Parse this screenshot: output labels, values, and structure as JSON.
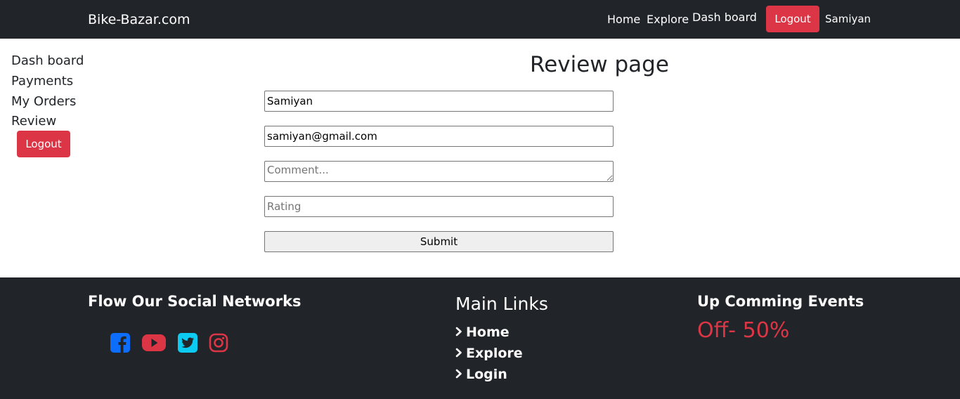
{
  "navbar": {
    "brand": "Bike-Bazar.com",
    "links": [
      "Home",
      "Explore",
      "Dash board"
    ],
    "logout_label": "Logout",
    "user_name": "Samiyan"
  },
  "sidebar": {
    "items": [
      "Dash board",
      "Payments",
      "My Orders",
      "Review"
    ],
    "logout_label": "Logout"
  },
  "main": {
    "title": "Review page",
    "form": {
      "name_value": "Samiyan",
      "email_value": "samiyan@gmail.com",
      "comment_placeholder": "Comment...",
      "rating_placeholder": "Rating",
      "submit_label": "Submit"
    }
  },
  "footer": {
    "social_heading": "Flow Our Social Networks",
    "social_icons": [
      "facebook-icon",
      "youtube-icon",
      "twitter-icon",
      "instagram-icon"
    ],
    "links_heading": "Main Links",
    "links": [
      "Home",
      "Explore",
      "Login"
    ],
    "events_heading": "Up Comming Events",
    "offer": "Off- 50%"
  },
  "colors": {
    "dark": "#212529",
    "danger": "#dc3545",
    "facebook": "#0d6efd",
    "twitter": "#0dcaf0"
  }
}
